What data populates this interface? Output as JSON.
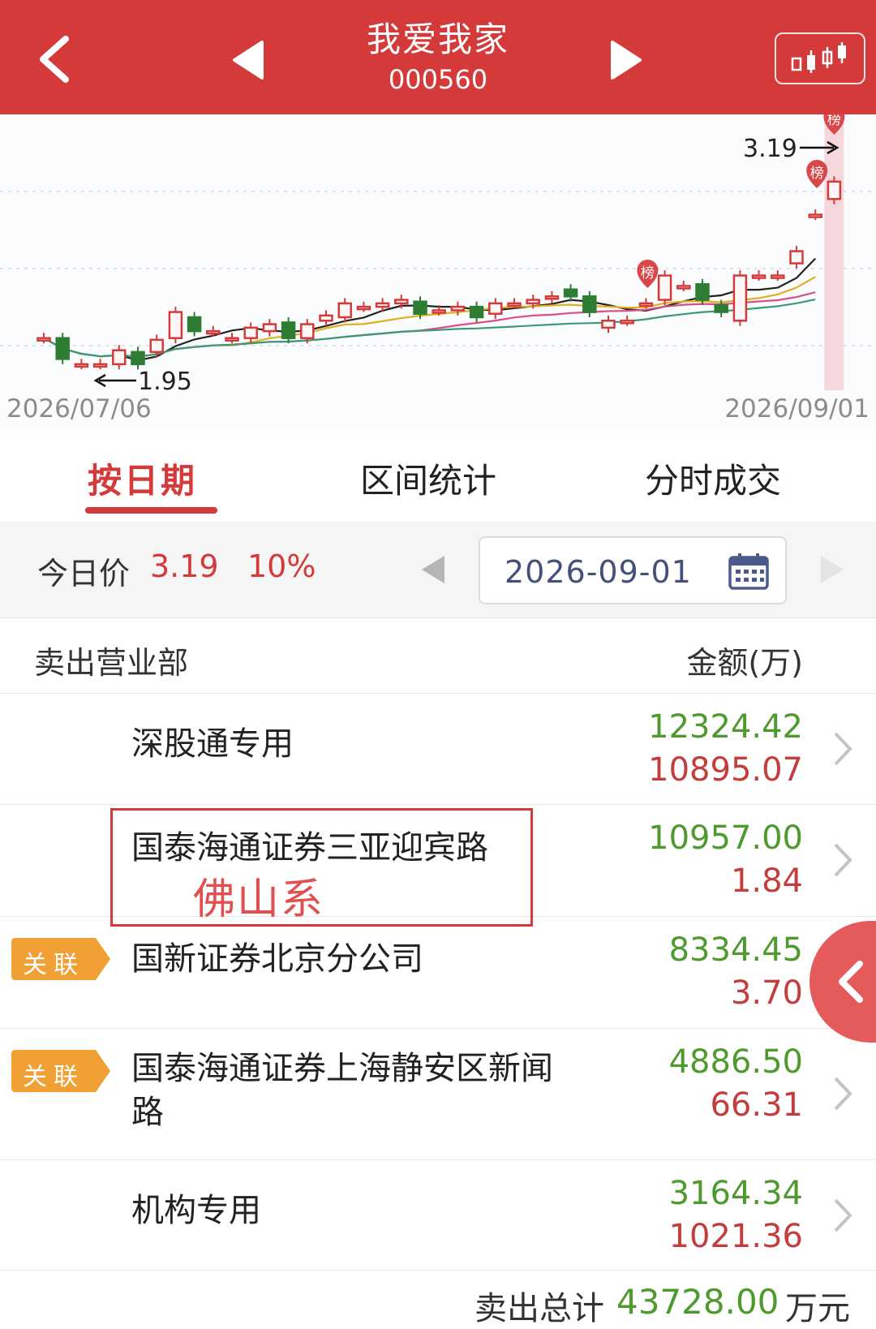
{
  "header": {
    "title": "我爱我家",
    "code": "000560"
  },
  "chart_data": {
    "type": "candlestick",
    "x_start": "2026/07/06",
    "x_end": "2026/09/01",
    "high_label": "3.19",
    "low_label": "1.95",
    "marker_label": "榜",
    "candles": [
      {
        "o": 2.2,
        "c": 2.2,
        "dir": "up"
      },
      {
        "o": 2.2,
        "c": 2.08,
        "dir": "down"
      },
      {
        "o": 2.05,
        "c": 2.05,
        "dir": "up"
      },
      {
        "o": 2.05,
        "c": 2.05,
        "dir": "up"
      },
      {
        "o": 2.05,
        "c": 2.13,
        "dir": "up"
      },
      {
        "o": 2.12,
        "c": 2.05,
        "dir": "down"
      },
      {
        "o": 2.12,
        "c": 2.19,
        "dir": "up"
      },
      {
        "o": 2.2,
        "c": 2.35,
        "dir": "up"
      },
      {
        "o": 2.32,
        "c": 2.24,
        "dir": "down"
      },
      {
        "o": 2.24,
        "c": 2.24,
        "dir": "up"
      },
      {
        "o": 2.2,
        "c": 2.2,
        "dir": "up"
      },
      {
        "o": 2.2,
        "c": 2.26,
        "dir": "up"
      },
      {
        "o": 2.24,
        "c": 2.28,
        "dir": "up"
      },
      {
        "o": 2.29,
        "c": 2.2,
        "dir": "down"
      },
      {
        "o": 2.2,
        "c": 2.28,
        "dir": "up"
      },
      {
        "o": 2.3,
        "c": 2.33,
        "dir": "up"
      },
      {
        "o": 2.32,
        "c": 2.4,
        "dir": "up"
      },
      {
        "o": 2.38,
        "c": 2.38,
        "dir": "up"
      },
      {
        "o": 2.38,
        "c": 2.4,
        "dir": "up"
      },
      {
        "o": 2.4,
        "c": 2.42,
        "dir": "up"
      },
      {
        "o": 2.41,
        "c": 2.34,
        "dir": "down"
      },
      {
        "o": 2.36,
        "c": 2.36,
        "dir": "up"
      },
      {
        "o": 2.36,
        "c": 2.38,
        "dir": "up"
      },
      {
        "o": 2.38,
        "c": 2.32,
        "dir": "down"
      },
      {
        "o": 2.34,
        "c": 2.4,
        "dir": "up"
      },
      {
        "o": 2.4,
        "c": 2.4,
        "dir": "up"
      },
      {
        "o": 2.4,
        "c": 2.42,
        "dir": "up"
      },
      {
        "o": 2.43,
        "c": 2.44,
        "dir": "up"
      },
      {
        "o": 2.48,
        "c": 2.44,
        "dir": "down"
      },
      {
        "o": 2.44,
        "c": 2.35,
        "dir": "down"
      },
      {
        "o": 2.26,
        "c": 2.3,
        "dir": "up"
      },
      {
        "o": 2.3,
        "c": 2.3,
        "dir": "up"
      },
      {
        "o": 2.4,
        "c": 2.4,
        "dir": "up"
      },
      {
        "o": 2.42,
        "c": 2.56,
        "dir": "up"
      },
      {
        "o": 2.5,
        "c": 2.5,
        "dir": "up"
      },
      {
        "o": 2.51,
        "c": 2.42,
        "dir": "down"
      },
      {
        "o": 2.39,
        "c": 2.35,
        "dir": "down"
      },
      {
        "o": 2.3,
        "c": 2.56,
        "dir": "up"
      },
      {
        "o": 2.56,
        "c": 2.56,
        "dir": "up"
      },
      {
        "o": 2.56,
        "c": 2.56,
        "dir": "up"
      },
      {
        "o": 2.63,
        "c": 2.7,
        "dir": "up"
      },
      {
        "o": 2.91,
        "c": 2.91,
        "dir": "up"
      },
      {
        "o": 3.0,
        "c": 3.1,
        "dir": "up"
      }
    ]
  },
  "tabs": [
    {
      "label": "按日期",
      "active": true
    },
    {
      "label": "区间统计",
      "active": false
    },
    {
      "label": "分时成交",
      "active": false
    }
  ],
  "price_bar": {
    "label": "今日价",
    "price": "3.19",
    "change": "10%",
    "date": "2026-09-01"
  },
  "table": {
    "col_left": "卖出营业部",
    "col_right": "金额(万)",
    "rows": [
      {
        "name": "深股通专用",
        "v1": "12324.42",
        "v2": "10895.07",
        "tag": ""
      },
      {
        "name": "国泰海通证券三亚迎宾路",
        "v1": "10957.00",
        "v2": "1.84",
        "tag": "",
        "note": "佛山系"
      },
      {
        "name": "国新证券北京分公司",
        "v1": "8334.45",
        "v2": "3.70",
        "tag": "关联"
      },
      {
        "name": "国泰海通证券上海静安区新闻",
        "name2": "路",
        "v1": "4886.50",
        "v2": "66.31",
        "tag": "关联"
      },
      {
        "name": "机构专用",
        "v1": "3164.34",
        "v2": "1021.36",
        "tag": ""
      }
    ]
  },
  "footer": {
    "label": "卖出总计",
    "value": "43728.00",
    "unit": "万元"
  },
  "colors": {
    "brand_red": "#d43a3a",
    "up_red": "#d43a3a",
    "down_green": "#2e7d32",
    "value_green": "#4f9a2f",
    "value_red": "#c33d3d",
    "tag_orange": "#f0a035"
  }
}
